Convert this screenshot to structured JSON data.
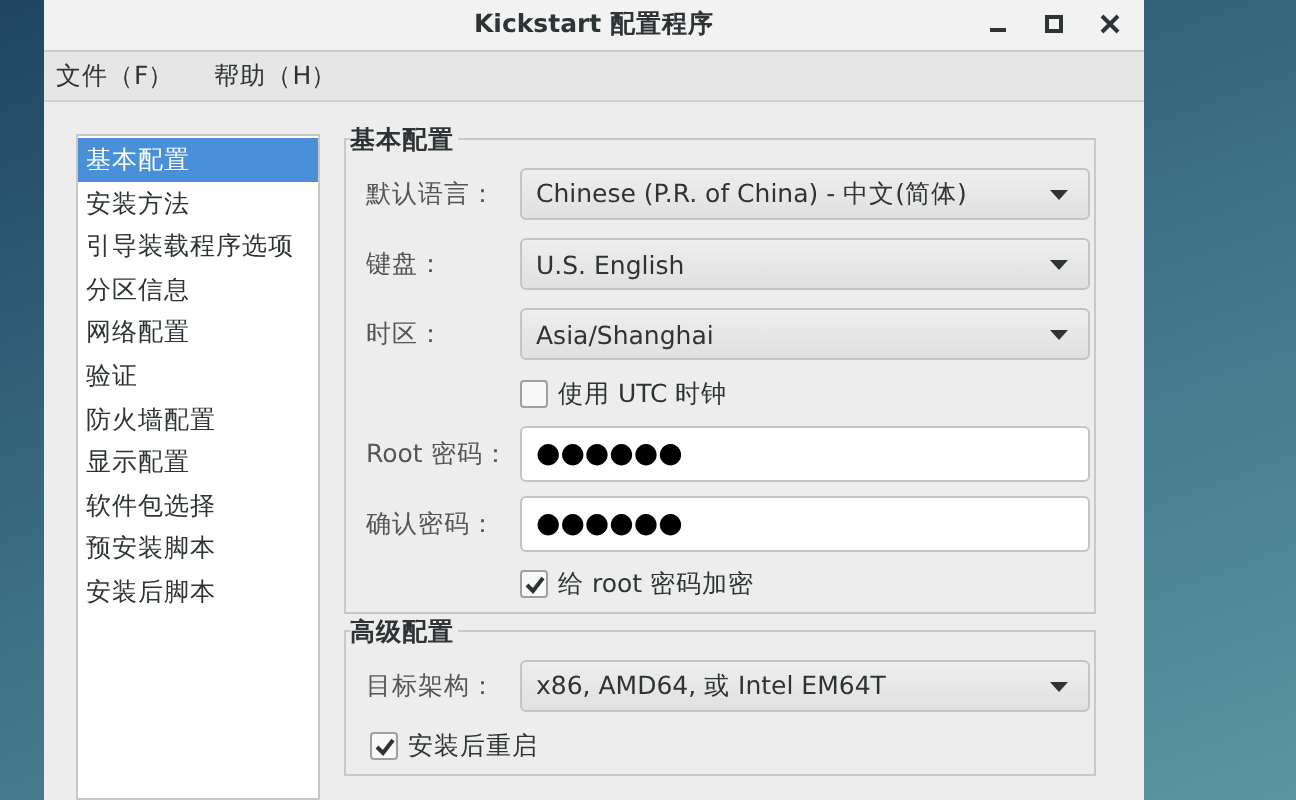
{
  "window": {
    "title": "Kickstart 配置程序"
  },
  "menu": [
    "文件（F）",
    "帮助（H）"
  ],
  "sidebar": {
    "items": [
      {
        "label": "基本配置",
        "selected": true
      },
      {
        "label": "安装方法",
        "selected": false
      },
      {
        "label": "引导装载程序选项",
        "selected": false
      },
      {
        "label": "分区信息",
        "selected": false
      },
      {
        "label": "网络配置",
        "selected": false
      },
      {
        "label": "验证",
        "selected": false
      },
      {
        "label": "防火墙配置",
        "selected": false
      },
      {
        "label": "显示配置",
        "selected": false
      },
      {
        "label": "软件包选择",
        "selected": false
      },
      {
        "label": "预安装脚本",
        "selected": false
      },
      {
        "label": "安装后脚本",
        "selected": false
      }
    ]
  },
  "sections": [
    {
      "title": "基本配置",
      "rows": [
        {
          "kind": "dropdown",
          "label": "默认语言：",
          "value": "Chinese (P.R. of China) - 中文(简体)"
        },
        {
          "kind": "dropdown",
          "label": "键盘：",
          "value": "U.S. English"
        },
        {
          "kind": "dropdown",
          "label": "时区：",
          "value": "Asia/Shanghai"
        },
        {
          "kind": "checkbox",
          "label": "使用  UTC 时钟",
          "checked": false
        },
        {
          "kind": "password",
          "label": "Root 密码：",
          "value": "●●●●●●"
        },
        {
          "kind": "password",
          "label": "确认密码：",
          "value": "●●●●●●"
        },
        {
          "kind": "checkbox",
          "label": "给  root 密码加密",
          "checked": true
        }
      ]
    },
    {
      "title": "高级配置",
      "rows": [
        {
          "kind": "dropdown",
          "label": "目标架构：",
          "value": "x86, AMD64, 或  Intel EM64T"
        },
        {
          "kind": "wide-checkbox",
          "label": "安装后重启",
          "checked": true
        }
      ]
    }
  ]
}
